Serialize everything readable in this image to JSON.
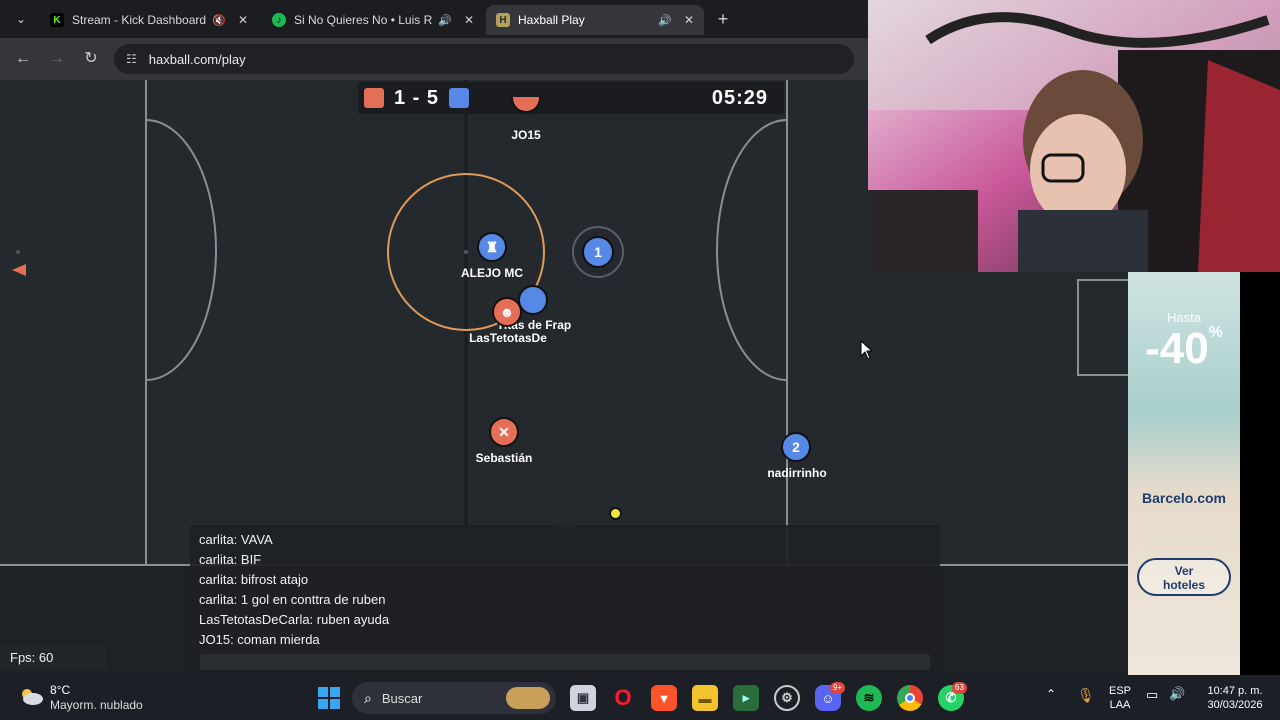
{
  "browser": {
    "tabs": [
      {
        "title": "Stream - Kick Dashboard",
        "favicon": "K",
        "favicon_color": "#53fc18",
        "sound_icon": "muted-speaker-icon"
      },
      {
        "title": "Si No Quieres No • Luis R C",
        "favicon": "♪",
        "favicon_color": "#1db954",
        "sound_icon": "speaker-icon"
      },
      {
        "title": "Haxball Play",
        "favicon": "H",
        "favicon_color": "#b5a05b",
        "sound_icon": "speaker-icon"
      }
    ],
    "url": "haxball.com/play"
  },
  "scoreboard": {
    "score": "1 - 5",
    "timer": "05:29",
    "red_color": "#e56e56",
    "blue_color": "#5689e5"
  },
  "players": [
    {
      "name": "JO15",
      "team": "red",
      "avatar": ""
    },
    {
      "name": "ALEJO MC",
      "team": "blue",
      "avatar": "♜"
    },
    {
      "name": "",
      "team": "blue",
      "avatar": "1"
    },
    {
      "name": "Titas de Frap",
      "team": "blue",
      "avatar": ""
    },
    {
      "name": "LasTetotasDe",
      "team": "red",
      "avatar": "☻"
    },
    {
      "name": "Sebastián",
      "team": "red",
      "avatar": "✕"
    },
    {
      "name": "nadirrinho",
      "team": "blue",
      "avatar": "2"
    }
  ],
  "chat": {
    "messages": [
      "carlita: VAVA",
      "carlita: BIF",
      "carlita: bifrost atajo",
      "carlita: 1 gol en conttra de ruben",
      "LasTetotasDeCarla: ruben ayuda",
      "JO15: coman mierda"
    ]
  },
  "fps": "Fps: 60",
  "ad": {
    "hasta": "Hasta",
    "discount": "-40",
    "percent": "%",
    "brand": "Barcelo.com",
    "cta_line1": "Ver",
    "cta_line2": "hoteles"
  },
  "taskbar": {
    "temperature": "8°C",
    "weather": "Mayorm. nublado",
    "search_placeholder": "Buscar",
    "discord_badge": "9+",
    "whatsapp_badge": "63",
    "lang1": "ESP",
    "lang2": "LAA",
    "time": "10:47 p. m.",
    "date": "30/03/2026"
  }
}
